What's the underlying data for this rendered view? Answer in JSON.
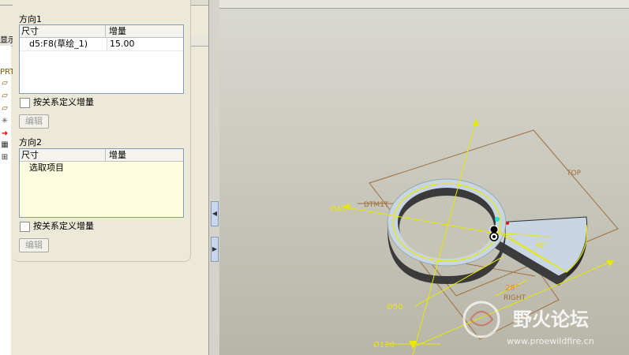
{
  "panel": {
    "direction1": {
      "title": "方向1",
      "col_dim": "尺寸",
      "col_inc": "增量",
      "rows": [
        {
          "dim": "d5:F8(草绘_1)",
          "inc": "15.00"
        }
      ],
      "checkbox_label": "按关系定义增量",
      "edit_label": "编辑"
    },
    "direction2": {
      "title": "方向2",
      "col_dim": "尺寸",
      "col_inc": "增量",
      "placeholder_row": "选取项目",
      "checkbox_label": "按关系定义增量",
      "edit_label": "编辑"
    }
  },
  "background": {
    "tree_tab_text": "显示",
    "tree_prt_text": "PRT"
  },
  "viewport": {
    "labels": {
      "dtm": "DTM1T",
      "top": "TOP",
      "right": "RIGHT",
      "dim_40": "Ø40",
      "dim_50": "Ø50",
      "dim_120": "Ø120",
      "dim_30": "30°",
      "dim_28": "28°"
    },
    "watermark": {
      "cn": "野火论坛",
      "url": "www.proewildfire.cn"
    },
    "colors": {
      "dimension": "#e8e800",
      "datum_plane": "#a0703c",
      "part": "#c8d6e4",
      "part_edge": "#303030",
      "watermark": "#c0392b"
    }
  }
}
